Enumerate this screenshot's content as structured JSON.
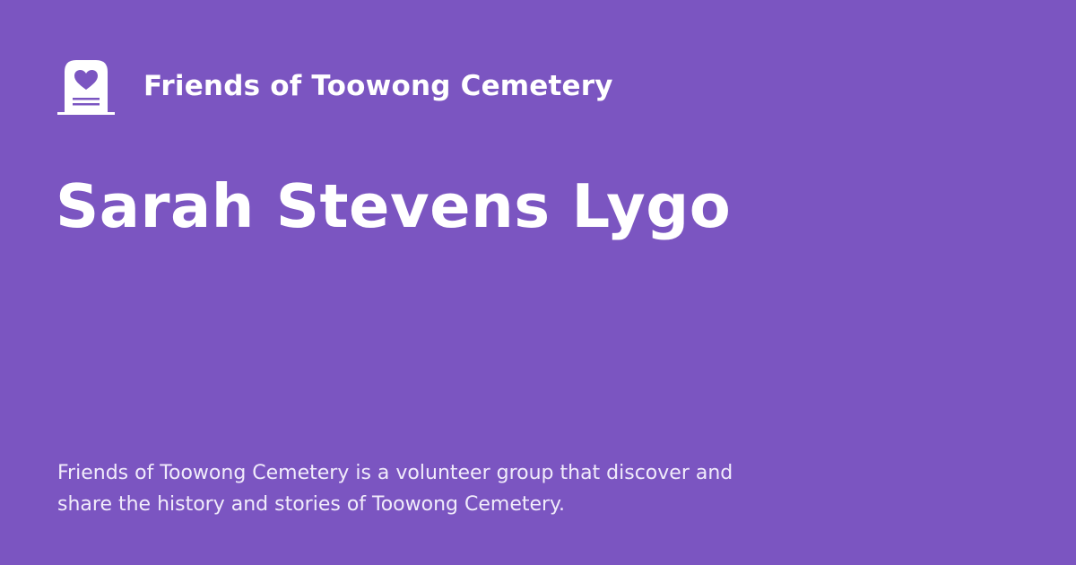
{
  "header": {
    "logo_icon": "heart-headstone-icon",
    "site_name": "Friends of Toowong Cemetery"
  },
  "main": {
    "title": "Sarah Stevens Lygo"
  },
  "footer": {
    "description": "Friends of Toowong Cemetery is a volunteer group that discover and share the history and stories of Toowong Cemetery."
  },
  "colors": {
    "background": "#7b55c1",
    "text": "#ffffff"
  }
}
